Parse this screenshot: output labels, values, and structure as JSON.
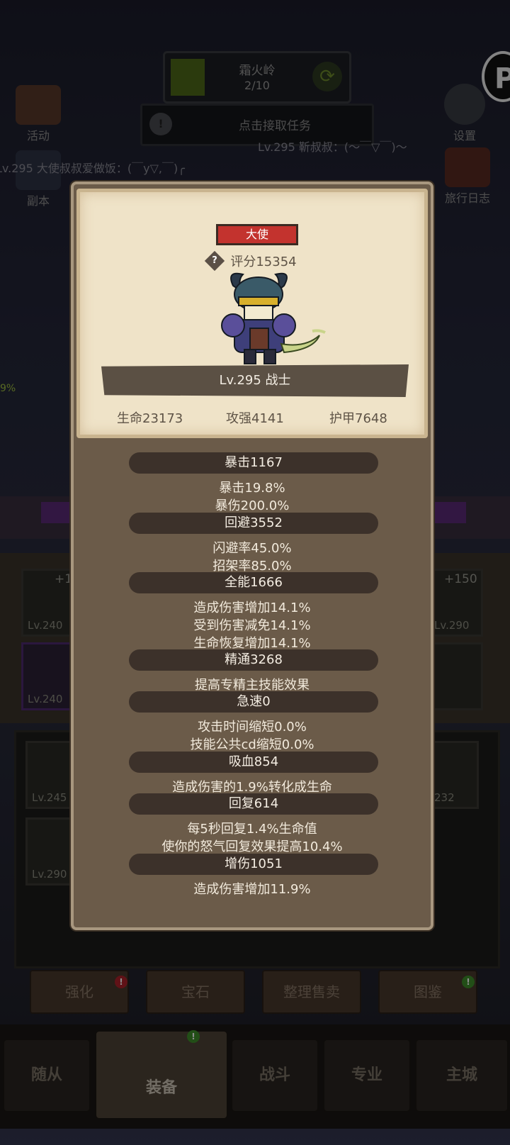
{
  "stage": {
    "name": "霜火岭",
    "progress": "2/10"
  },
  "quest": {
    "button_label": "点击接取任务"
  },
  "side_buttons": {
    "activity": "活动",
    "dungeon": "副本",
    "settings": "设置",
    "travel_log": "旅行日志"
  },
  "chat": [
    "Lv.295 靳叔叔：(～￣▽￣)～",
    "Lv.295 大使叔叔爱做饭：(￣y▽,￣)╭"
  ],
  "popup": {
    "title_badge": "大使",
    "score": "评分15354",
    "level_class": "Lv.295 战士",
    "base_stats": {
      "hp": "生命23173",
      "attack": "攻强4141",
      "armor": "护甲7648"
    },
    "stats": [
      {
        "head": "暴击1167",
        "lines": [
          "暴击19.8%",
          "暴伤200.0%"
        ]
      },
      {
        "head": "回避3552",
        "lines": [
          "闪避率45.0%",
          "招架率85.0%"
        ]
      },
      {
        "head": "全能1666",
        "lines": [
          "造成伤害增加14.1%",
          "受到伤害减免14.1%",
          "生命恢复增加14.1%"
        ]
      },
      {
        "head": "精通3268",
        "lines": [
          "提高专精主技能效果"
        ]
      },
      {
        "head": "急速0",
        "lines": [
          "攻击时间缩短0.0%",
          "技能公共cd缩短0.0%"
        ]
      },
      {
        "head": "吸血854",
        "lines": [
          "造成伤害的1.9%转化成生命"
        ]
      },
      {
        "head": "回复614",
        "lines": [
          "每5秒回复1.4%生命值",
          "使你的怒气回复效果提高10.4%"
        ]
      },
      {
        "head": "增伤1051",
        "lines": [
          "造成伤害增加11.9%"
        ]
      }
    ]
  },
  "slots": {
    "left_top_bonus": "+1",
    "right_top_bonus": "+150",
    "lv_left_1": "Lv.240",
    "lv_left_2": "Lv.240",
    "lv_right_1": "Lv.290",
    "lv_inv_1": "Lv.245",
    "lv_inv_2": "Lv.290",
    "lv_inv_3": "232"
  },
  "actions": [
    "强化",
    "宝石",
    "整理售卖",
    "图鉴"
  ],
  "nav": [
    "随从",
    "装备",
    "战斗",
    "专业",
    "主城"
  ],
  "p_badge": "P",
  "side_percent": "9%",
  "badges": {
    "info": "!",
    "refresh": "⟳",
    "help": "?"
  }
}
